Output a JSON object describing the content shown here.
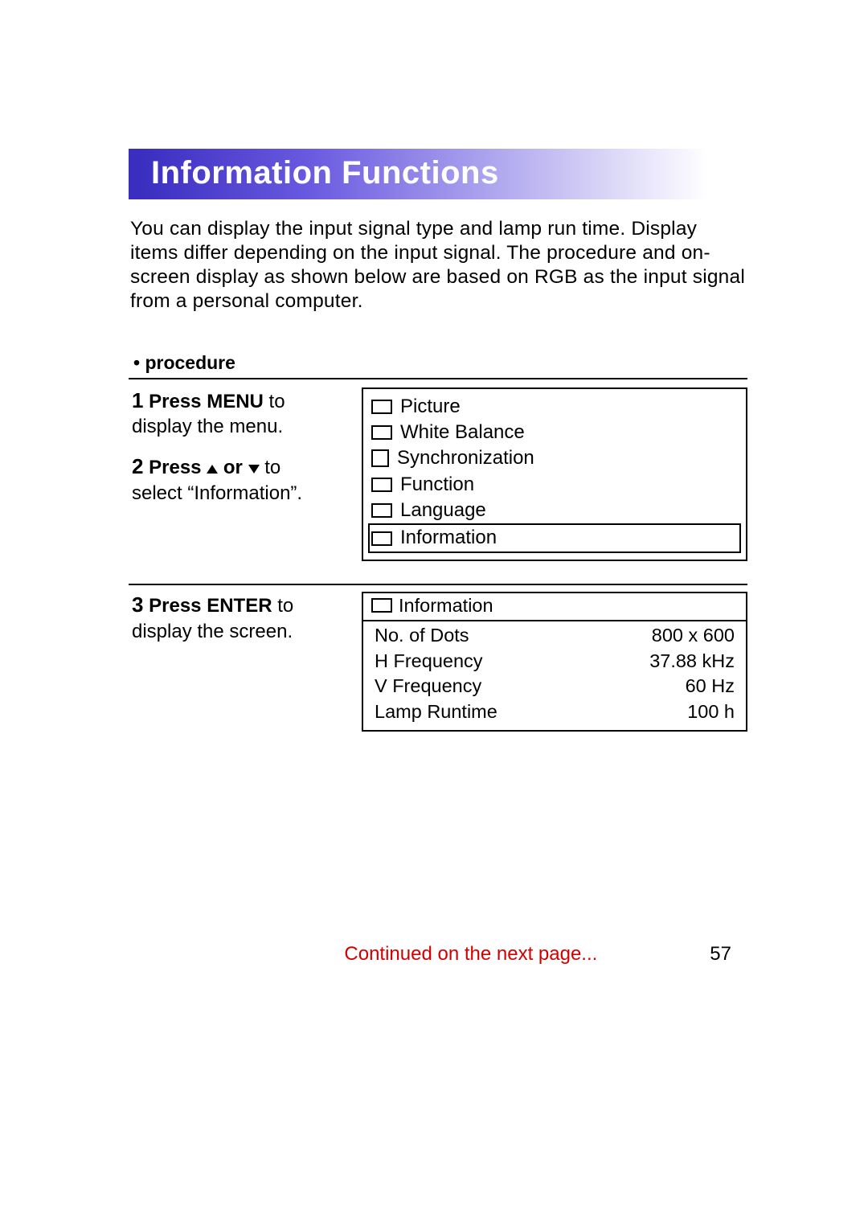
{
  "heading": "Information Functions",
  "intro": "You can display the input signal type and lamp run time. Display items differ depending on the input signal. The procedure and on-screen display as shown below are based on RGB as the input signal from a personal computer.",
  "procedure_label": "• procedure",
  "steps": {
    "s1": {
      "num": "1",
      "bold1": "Press MENU",
      "rest1": " to",
      "line2": "display the menu."
    },
    "s2": {
      "num": "2",
      "bold1": "Press ",
      "bold2": " or ",
      "rest1": " to",
      "line2": "select “Information”."
    },
    "s3": {
      "num": "3",
      "bold1": "Press ENTER",
      "rest1": " to",
      "line2": "display the screen."
    }
  },
  "menu_items": [
    {
      "label": "Picture"
    },
    {
      "label": "White Balance"
    },
    {
      "label": "Synchronization"
    },
    {
      "label": "Function"
    },
    {
      "label": "Language"
    },
    {
      "label": "Information",
      "selected": true
    }
  ],
  "info_panel": {
    "title": "Information",
    "rows": [
      {
        "label": "No. of Dots",
        "value": "800 x 600"
      },
      {
        "label": "H Frequency",
        "value": "37.88 kHz"
      },
      {
        "label": "V Frequency",
        "value": "60 Hz"
      },
      {
        "label": "Lamp Runtime",
        "value": "100 h"
      }
    ]
  },
  "footer": {
    "continued": "Continued on the next page...",
    "page": "57"
  }
}
